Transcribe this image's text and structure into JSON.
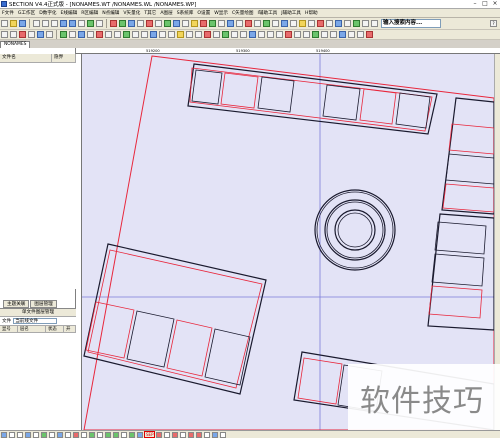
{
  "window": {
    "title": "SECTION V4.4正式版 - [NONAMES.WT /NONAMES.WL /NONAMES.WP]"
  },
  "menu": [
    "F文件",
    "G工作区",
    "D数字化",
    "E线编辑",
    "R区编辑",
    "N点编辑",
    "V矢量化",
    "T其它",
    "A图层",
    "S系统库",
    "O设置",
    "W显示",
    "C矢量绘图",
    "I辅助工具",
    "J辅助工具",
    "H帮助"
  ],
  "toolbar": {
    "search_value": "输入搜索内容..."
  },
  "workspace_tab": "NONAMES",
  "ruler_labels": [
    "519200",
    "519300",
    "519400"
  ],
  "left_panel": {
    "columns": [
      "文件名",
      "隐界"
    ],
    "buttons": [
      "主题关联",
      "图层管理"
    ],
    "layer_caption": "单文件图层管理",
    "file_label": "文件",
    "file_select": "当前线文件",
    "layer_columns": [
      "显号",
      "层名",
      "状态",
      "开"
    ]
  },
  "status": {
    "mode_label": "SEP"
  },
  "watermark": "软件技巧",
  "colors": {
    "accent_red": "#e8273c",
    "canvas_bg": "#e3e3f6",
    "line_dark": "#1a1a2e",
    "crosshair": "#7c7cd8"
  }
}
